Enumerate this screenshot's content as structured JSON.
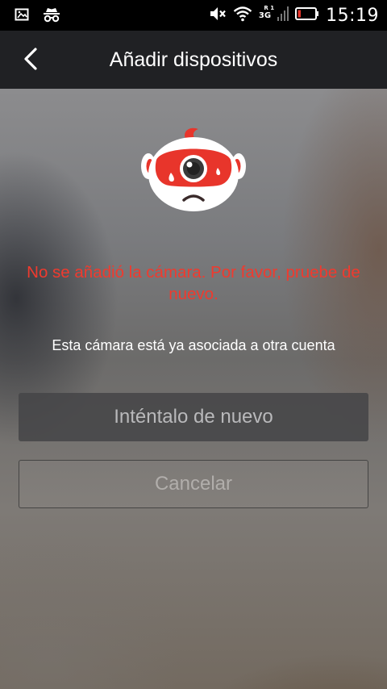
{
  "status_bar": {
    "time": "15:19",
    "network": "3G",
    "network_sup": "R 1",
    "icons": [
      "image-icon",
      "incognito-icon",
      "mute-icon",
      "wifi-icon",
      "signal-icon",
      "battery-icon"
    ]
  },
  "header": {
    "title": "Añadir dispositivos",
    "back_icon": "chevron-left-icon"
  },
  "main": {
    "error_message": "No se añadió la cámara. Por favor, pruebe de nuevo.",
    "info_message": "Esta cámara está ya asociada a otra cuenta",
    "retry_label": "Inténtalo de nuevo",
    "cancel_label": "Cancelar"
  },
  "colors": {
    "error_text": "#f03a2e",
    "header_bg": "#202124",
    "mascot_red": "#e8352b"
  }
}
